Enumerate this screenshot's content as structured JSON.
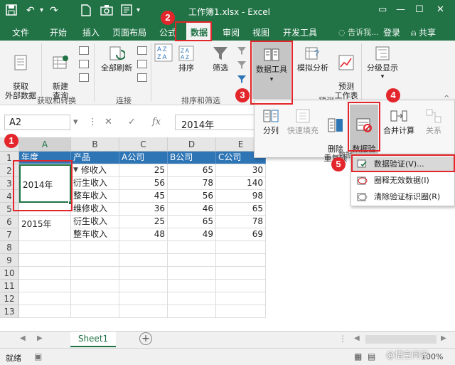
{
  "titlebar": {
    "save_icon": "save-icon",
    "undo_icon": "undo-icon",
    "title": "工作簿1.xlsx - Excel",
    "min": "—",
    "max": "☐",
    "close": "✕"
  },
  "menu": {
    "tabs": [
      "文件",
      "开始",
      "插入",
      "页面布局",
      "公式",
      "数据",
      "审阅",
      "视图",
      "开发工具"
    ],
    "tell_me": "告诉我...",
    "login": "登录",
    "share": "共享"
  },
  "ribbon": {
    "get_data": "获取\n外部数据",
    "new_query": "新建\n查询",
    "refresh_all": "全部刷新",
    "sort": "排序",
    "filter": "筛选",
    "data_tools": "数据工具",
    "what_if": "模拟分析",
    "forecast_sheet": "预测\n工作表",
    "outline": "分级显示",
    "groups": {
      "get_transform": "获取和转换",
      "connections": "连接",
      "sort_filter": "排序和筛选",
      "forecast": "预测"
    }
  },
  "formula_bar": {
    "name_box": "A2",
    "fx": "fx",
    "value": "2014年"
  },
  "sheet": {
    "columns": [
      "A",
      "B",
      "C",
      "D",
      "E"
    ],
    "rows": [
      "1",
      "2",
      "3",
      "4",
      "5",
      "6",
      "7",
      "8",
      "9",
      "10",
      "11",
      "12",
      "13"
    ],
    "header_row": [
      "年度",
      "产品",
      "A公司",
      "B公司",
      "C公司"
    ],
    "data": [
      [
        "2014年",
        "修收入",
        "25",
        "65",
        "30"
      ],
      [
        "",
        "衍生收入",
        "56",
        "78",
        "140"
      ],
      [
        "",
        "整车收入",
        "45",
        "56",
        "98"
      ],
      [
        "",
        "维修收入",
        "36",
        "46",
        "65"
      ],
      [
        "2015年",
        "衍生收入",
        "25",
        "65",
        "78"
      ],
      [
        "",
        "整车收入",
        "48",
        "49",
        "69"
      ]
    ],
    "sheet_tab": "Sheet1",
    "add_sheet": "+"
  },
  "data_tools_panel": {
    "split": "分列",
    "flash_fill": "快速填充",
    "remove_dup": "删除\n重复项",
    "validation": "数据验\n证▾",
    "consolidate": "合并计算",
    "relationships": "关系",
    "group_label": "数据"
  },
  "validation_menu": {
    "items": [
      "数据验证(V)...",
      "圈释无效数据(I)",
      "清除验证标识圈(R)"
    ]
  },
  "status": {
    "ready": "就绪",
    "zoom": "100%"
  },
  "badges": [
    "1",
    "2",
    "3",
    "4",
    "5"
  ],
  "watermark": "@悟空问答",
  "colors": {
    "excel_green": "#217346",
    "header_blue": "#2e75b6",
    "annotation_red": "#e3262b"
  }
}
